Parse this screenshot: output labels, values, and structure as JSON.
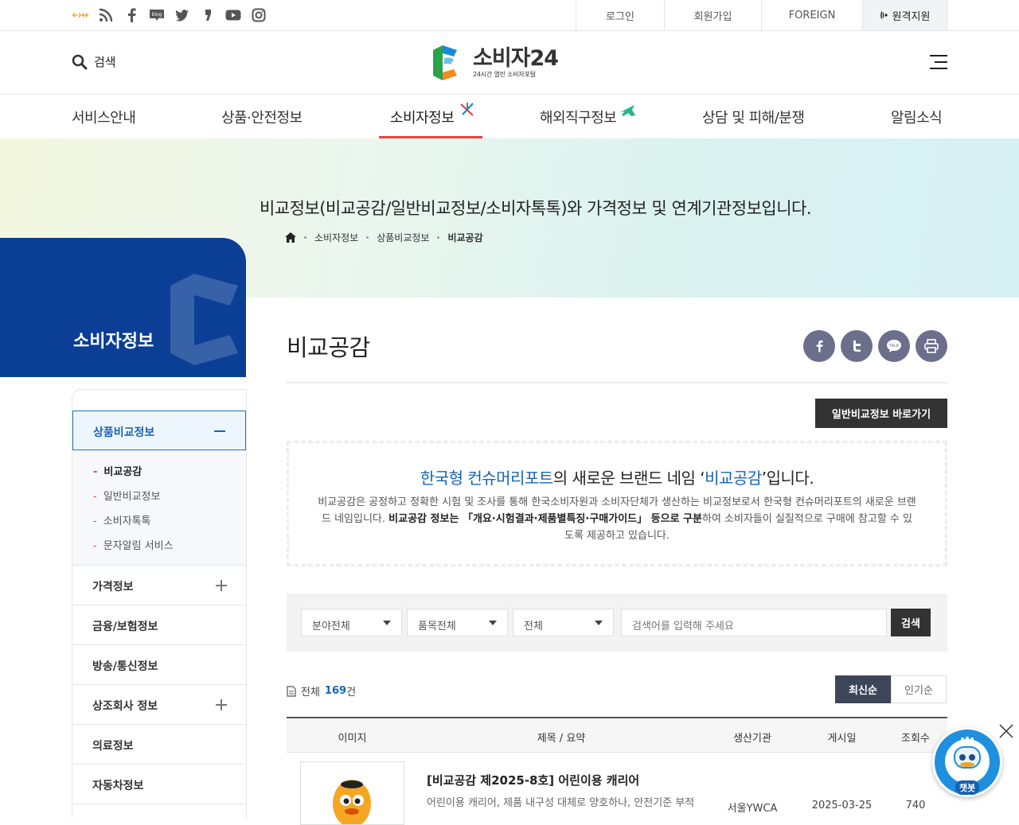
{
  "util_links": [
    "로그인",
    "회원가입",
    "FOREIGN",
    "원격지원"
  ],
  "sns_icons": [
    "eg-icon",
    "rss-icon",
    "facebook-icon",
    "blog-icon",
    "twitter-icon",
    "kakao-story-icon",
    "youtube-icon",
    "instagram-icon"
  ],
  "header": {
    "search_label": "검색",
    "logo_name": "소비자24",
    "logo_sub": "24시간 열린 소비자포털"
  },
  "gnb": [
    "서비스안내",
    "상품·안전정보",
    "소비자정보",
    "해외직구정보",
    "상담 및 피해/분쟁",
    "알림소식"
  ],
  "hero": {
    "title": "비교정보(비교공감/일반비교정보/소비자톡톡)와 가격정보 및 연계기관정보입니다.",
    "breadcrumb": [
      "소비자정보",
      "상품비교정보",
      "비교공감"
    ]
  },
  "side": {
    "title": "소비자정보",
    "active": "상품비교정보",
    "sub": [
      "비교공감",
      "일반비교정보",
      "소비자톡톡",
      "문자알림 서비스"
    ],
    "items": [
      "가격정보",
      "금융/보험정보",
      "방송/통신정보",
      "상조회사 정보",
      "의료정보",
      "자동차정보"
    ]
  },
  "content": {
    "title": "비교공감",
    "go_button": "일반비교정보 바로가기",
    "intro_h1": "한국형 컨슈머리포트",
    "intro_h2": "의 새로운 브랜드 네임 ‘",
    "intro_h3": "비교공감",
    "intro_h4": "’입니다.",
    "intro_p1": "비교공감은 공정하고 정확한 시험 및 조사를 통해 한국소비자원과 소비자단체가 생산하는 비교정보로서 한국형 컨슈머리포트의 새로운 브랜드 네임입니다. ",
    "intro_p2": "비교공감 정보는 「개요·시험결과·제품별특징·구매가이드」 등으로 구분",
    "intro_p3": "하여 소비자들이 실질적으로 구매에 참고할 수 있도록 제공하고 있습니다."
  },
  "search": {
    "field": "분야전체",
    "item": "품목전체",
    "scope": "전체",
    "placeholder": "검색어를 입력해 주세요",
    "button": "검색"
  },
  "list": {
    "total_label": "전체",
    "total_count": "169",
    "total_unit": "건",
    "sort": [
      "최신순",
      "인기순"
    ],
    "columns": [
      "이미지",
      "제목 / 요약",
      "생산기관",
      "게시일",
      "조회수"
    ],
    "rows": [
      {
        "title": "[비교공감 제2025-8호] 어린이용 캐리어",
        "summary": "어린이용 캐리어, 제품 내구성 대체로 양호하나, 안전기준 부적",
        "org": "서울YWCA",
        "date": "2025-03-25",
        "views": "740"
      }
    ]
  },
  "chatbot": {
    "label": "챗봇"
  }
}
